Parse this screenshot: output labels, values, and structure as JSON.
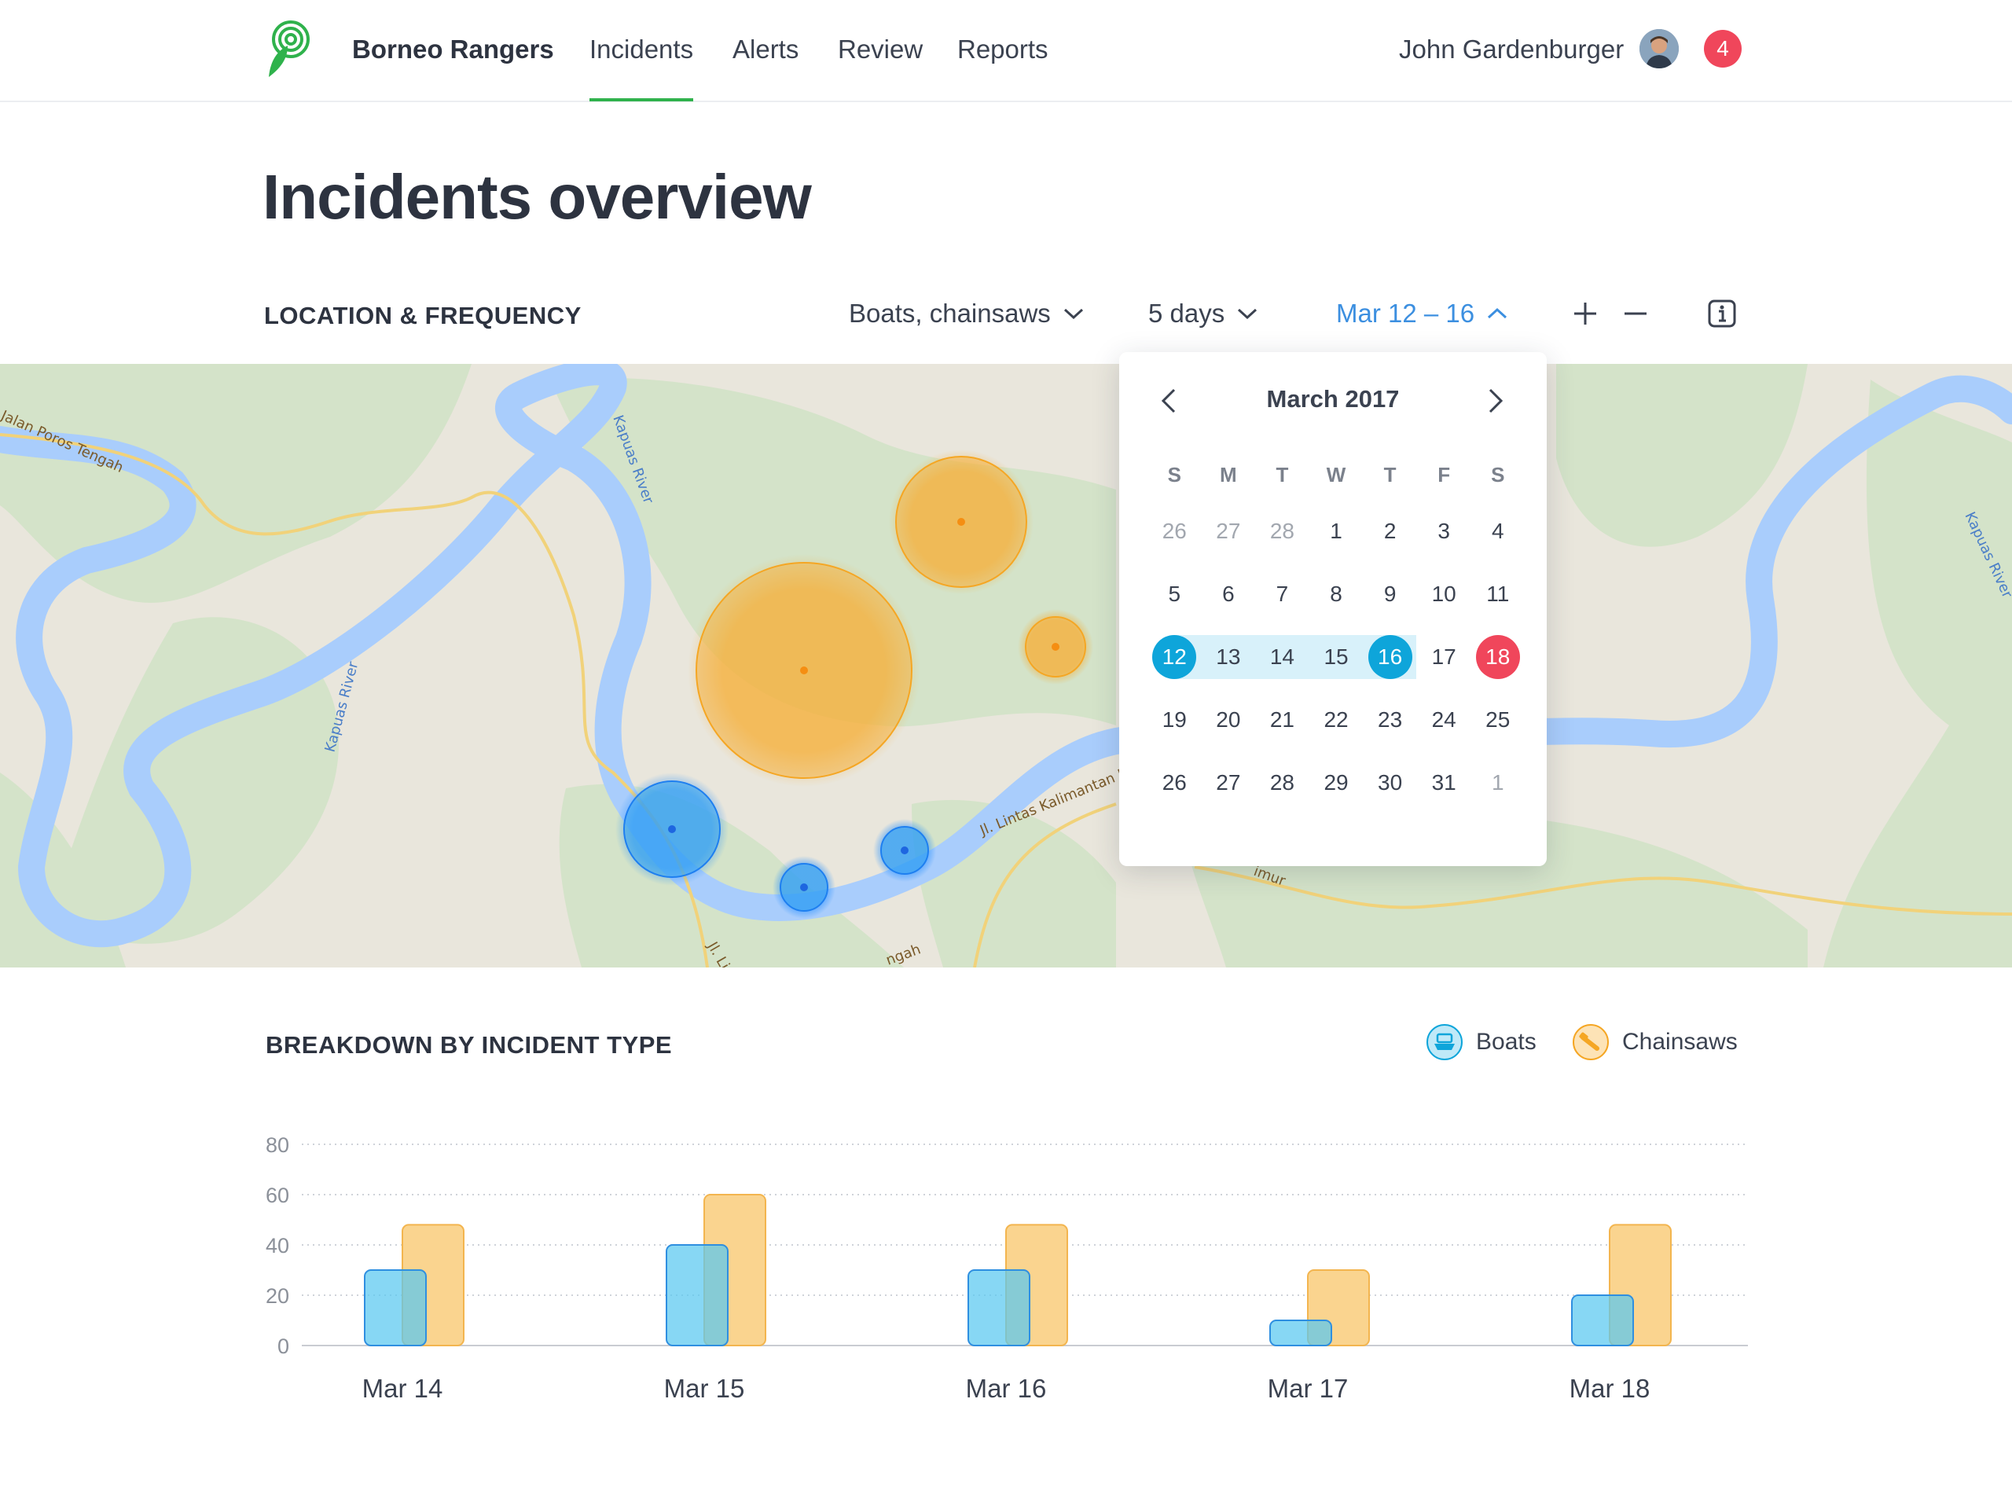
{
  "nav": {
    "brand": "Borneo Rangers",
    "items": [
      {
        "label": "Incidents",
        "active": true
      },
      {
        "label": "Alerts",
        "active": false
      },
      {
        "label": "Review",
        "active": false
      },
      {
        "label": "Reports",
        "active": false
      }
    ],
    "user_name": "John Gardenburger",
    "notification_count": "4"
  },
  "page": {
    "title": "Incidents overview"
  },
  "location": {
    "section_label": "LOCATION & FREQUENCY",
    "filter_types": "Boats, chainsaws",
    "filter_days": "5 days",
    "filter_range": "Mar 12 – 16"
  },
  "map_labels": {
    "road1": "Jalan Poros Tengah",
    "river1": "Kapuas River",
    "river2": "Kapuas River",
    "river3": "Kapuas River",
    "road2": "Jl. Lintas Kalimantan Poros Tengah",
    "road3": "Jl. Lintas K",
    "road4": "ngah",
    "road5": "imur"
  },
  "calendar": {
    "month_label": "March 2017",
    "weekdays": [
      "S",
      "M",
      "T",
      "W",
      "T",
      "F",
      "S"
    ],
    "weeks": [
      [
        {
          "d": "26",
          "m": true
        },
        {
          "d": "27",
          "m": true
        },
        {
          "d": "28",
          "m": true
        },
        {
          "d": "1"
        },
        {
          "d": "2"
        },
        {
          "d": "3"
        },
        {
          "d": "4"
        }
      ],
      [
        {
          "d": "5"
        },
        {
          "d": "6"
        },
        {
          "d": "7"
        },
        {
          "d": "8"
        },
        {
          "d": "9"
        },
        {
          "d": "10"
        },
        {
          "d": "11"
        }
      ],
      [
        {
          "d": "12",
          "sel": true
        },
        {
          "d": "13"
        },
        {
          "d": "14"
        },
        {
          "d": "15"
        },
        {
          "d": "16",
          "sel": true
        },
        {
          "d": "17"
        },
        {
          "d": "18",
          "today": true
        }
      ],
      [
        {
          "d": "19"
        },
        {
          "d": "20"
        },
        {
          "d": "21"
        },
        {
          "d": "22"
        },
        {
          "d": "23"
        },
        {
          "d": "24"
        },
        {
          "d": "25"
        }
      ],
      [
        {
          "d": "26"
        },
        {
          "d": "27"
        },
        {
          "d": "28"
        },
        {
          "d": "29"
        },
        {
          "d": "30"
        },
        {
          "d": "31"
        },
        {
          "d": "1",
          "m": true
        }
      ]
    ]
  },
  "breakdown": {
    "section_label": "BREAKDOWN BY INCIDENT TYPE",
    "legend": [
      {
        "label": "Boats",
        "icon": "boat-icon"
      },
      {
        "label": "Chainsaws",
        "icon": "chainsaw-icon"
      }
    ]
  },
  "chart_data": {
    "type": "bar",
    "categories": [
      "Mar 14",
      "Mar 15",
      "Mar 16",
      "Mar 17",
      "Mar 18"
    ],
    "series": [
      {
        "name": "Boats",
        "values": [
          30,
          40,
          30,
          10,
          20
        ],
        "color": "#7fd8f4"
      },
      {
        "name": "Chainsaws",
        "values": [
          48,
          60,
          48,
          30,
          48
        ],
        "color": "#fad48f"
      }
    ],
    "yticks": [
      "0",
      "20",
      "40",
      "60",
      "80"
    ],
    "ylim": [
      0,
      80
    ],
    "grid": true
  },
  "colors": {
    "accent": "#2fb24c",
    "link": "#3c8fe0",
    "alert": "#f0465b",
    "boat": "#0ea5da",
    "chainsaw": "#f5a623"
  }
}
